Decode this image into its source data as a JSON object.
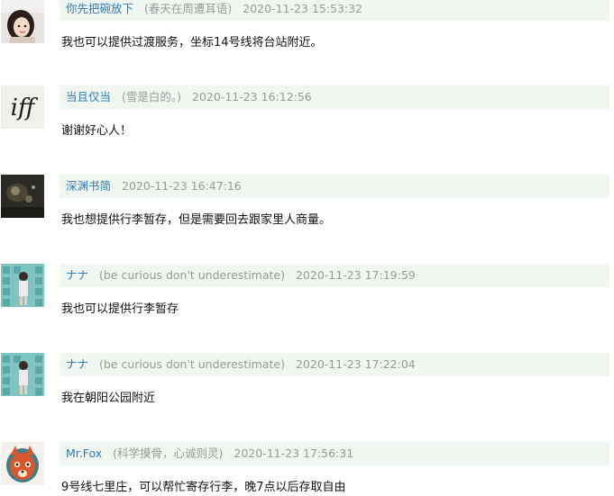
{
  "comments": [
    {
      "author": "你先把碗放下",
      "signature": "(春天在周遭耳语)",
      "time": "2020-11-23 15:53:32",
      "text": "我也可以提供过渡服务，坐标14号线将台站附近。",
      "avatar": "girl-photo-avatar"
    },
    {
      "author": "当且仅当",
      "signature": "(雪是白的。)",
      "time": "2020-11-23 16:12:56",
      "text": "谢谢好心人！",
      "avatar": "iff-text-avatar",
      "avatar_text": "iff"
    },
    {
      "author": "深渊书简",
      "signature": "",
      "time": "2020-11-23 16:47:16",
      "text": "我也想提供行李暂存，但是需要回去跟家里人商量。",
      "avatar": "dark-photo-avatar"
    },
    {
      "author": "ナナ",
      "signature": "(be curious don't underestimate)",
      "time": "2020-11-23 17:19:59",
      "text": "我也可以提供行李暂存",
      "avatar": "teal-wall-photo-avatar"
    },
    {
      "author": "ナナ",
      "signature": "(be curious don't underestimate)",
      "time": "2020-11-23 17:22:04",
      "text": "我在朝阳公园附近",
      "avatar": "teal-wall-photo-avatar"
    },
    {
      "author": "Mr.Fox",
      "signature": "(科学摸骨，心诚则灵)",
      "time": "2020-11-23 17:56:31",
      "text": "9号线七里庄，可以帮忙寄存行李，晚7点以后存取自由",
      "avatar": "fox-illustration-avatar"
    }
  ],
  "colors": {
    "author": "#2f7bb8",
    "meta_bg": "#f0f7f0",
    "muted": "#999999",
    "text": "#111111"
  }
}
